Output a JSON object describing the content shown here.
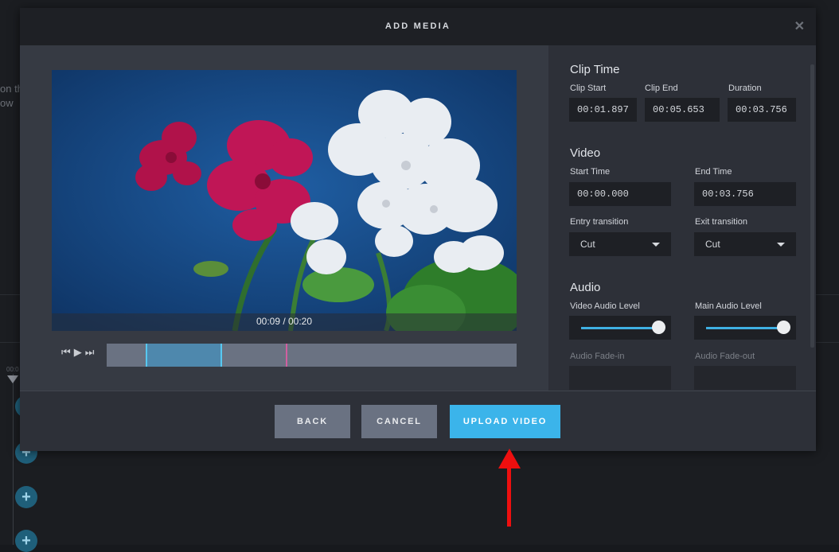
{
  "background": {
    "partial_text_1": "on th",
    "partial_text_2": "ow",
    "timeline_time": "00:0",
    "plus_icon": "plus-icon"
  },
  "modal": {
    "title": "ADD MEDIA",
    "close_icon": "close-icon"
  },
  "player": {
    "time_display": "00:09 / 00:20",
    "transport_icons": [
      "skip-back-icon",
      "play-icon",
      "skip-forward-icon"
    ],
    "selection_start_fraction": 0.095,
    "selection_end_fraction": 0.28,
    "playhead_fraction": 0.436
  },
  "clip_time": {
    "title": "Clip Time",
    "clip_start_label": "Clip Start",
    "clip_start_value": "00:01.897",
    "clip_end_label": "Clip End",
    "clip_end_value": "00:05.653",
    "duration_label": "Duration",
    "duration_value": "00:03.756"
  },
  "video": {
    "title": "Video",
    "start_time_label": "Start Time",
    "start_time_value": "00:00.000",
    "end_time_label": "End Time",
    "end_time_value": "00:03.756",
    "entry_transition_label": "Entry transition",
    "entry_transition_value": "Cut",
    "exit_transition_label": "Exit transition",
    "exit_transition_value": "Cut"
  },
  "audio": {
    "title": "Audio",
    "video_audio_level_label": "Video Audio Level",
    "video_audio_level": 1.0,
    "main_audio_level_label": "Main Audio Level",
    "main_audio_level": 1.0,
    "fade_in_label": "Audio Fade-in",
    "fade_out_label": "Audio Fade-out"
  },
  "footer": {
    "back_label": "BACK",
    "cancel_label": "CANCEL",
    "upload_label": "UPLOAD VIDEO"
  },
  "colors": {
    "accent": "#3bb4ea",
    "annotation_arrow": "#ee0f0f"
  }
}
